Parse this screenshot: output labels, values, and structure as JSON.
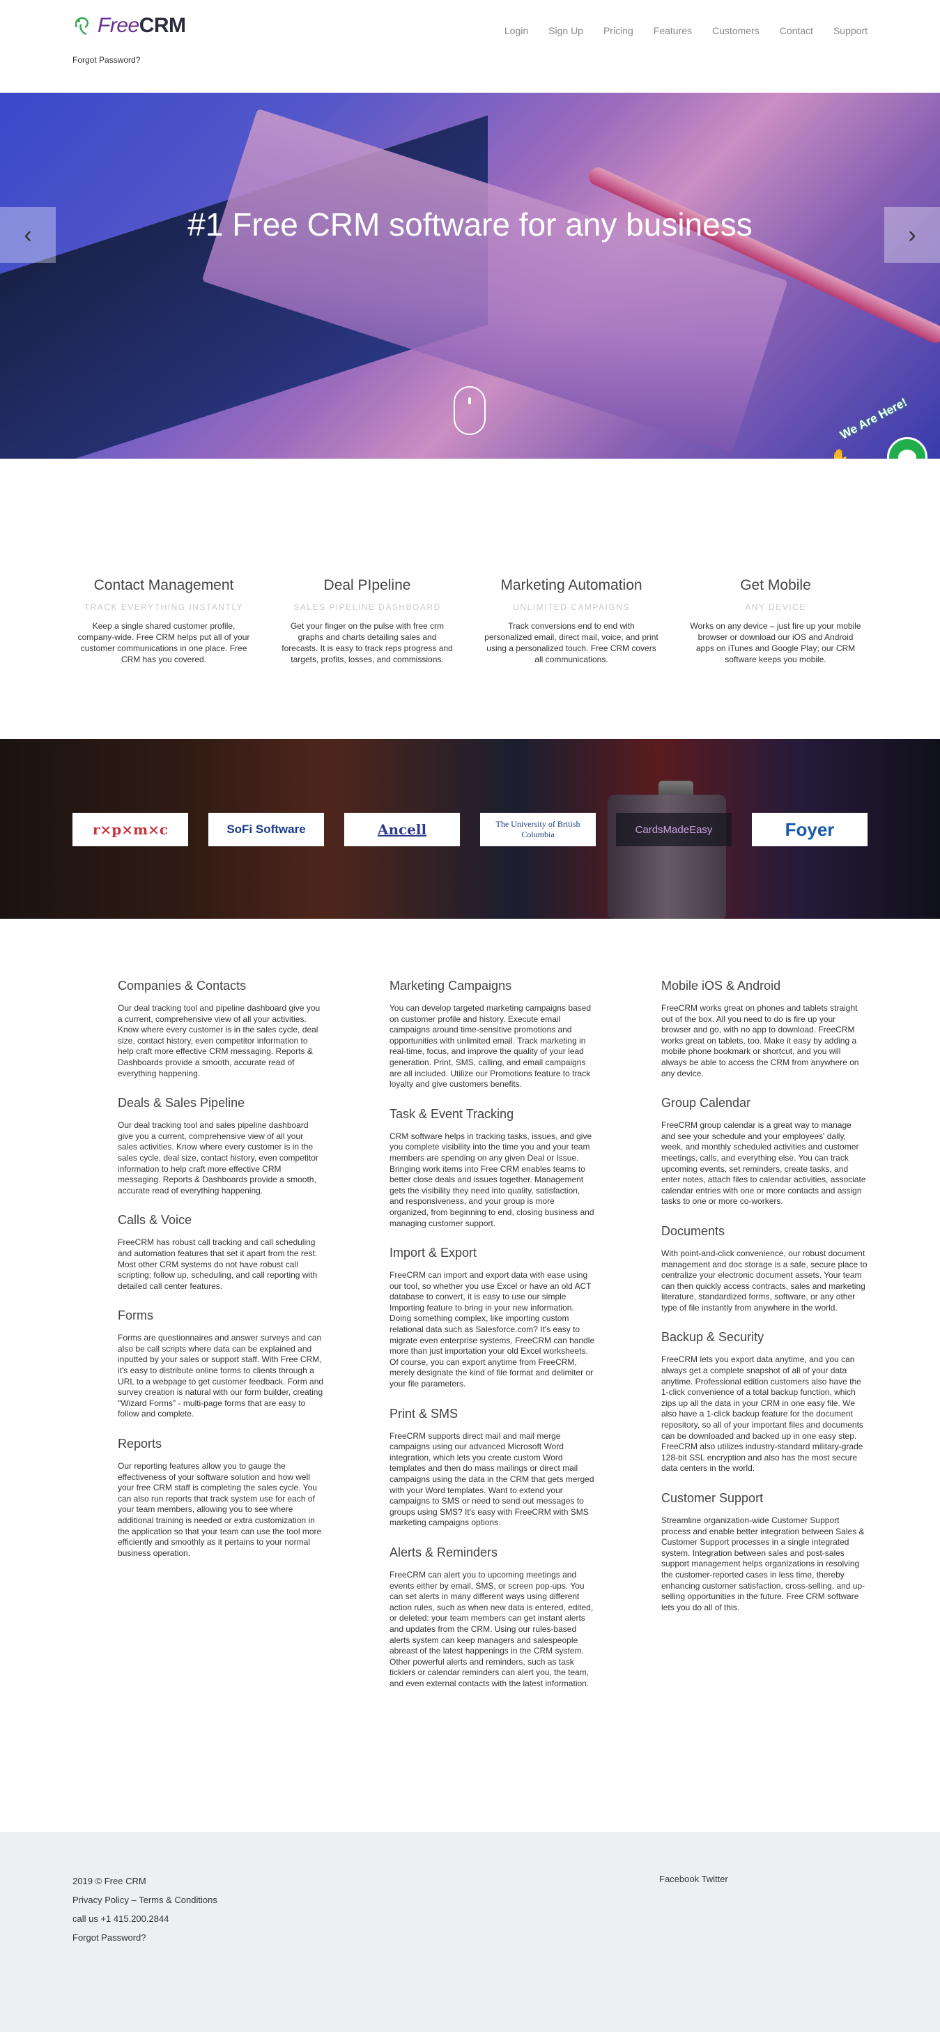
{
  "header": {
    "logo_free": "Free",
    "logo_crm": "CRM",
    "nav": [
      "Login",
      "Sign Up",
      "Pricing",
      "Features",
      "Customers",
      "Contact",
      "Support"
    ],
    "forgot_password": "Forgot Password?"
  },
  "hero": {
    "title": "#1 Free CRM software for any business",
    "prev_arrow": "‹",
    "next_arrow": "›",
    "chat_badge": "We Are Here!"
  },
  "features": [
    {
      "title": "Contact Management",
      "subtitle": "TRACK EVERYTHING INSTANTLY",
      "text": "Keep a single shared customer profile, company-wide. Free CRM helps put all of your customer communications in one place. Free CRM has you covered."
    },
    {
      "title": "Deal PIpeline",
      "subtitle": "SALES PIPELINE DASHBOARD",
      "text": "Get your finger on the pulse with free crm graphs and charts detailing sales and forecasts. It is easy to track reps progress and targets, profits, losses, and commissions."
    },
    {
      "title": "Marketing Automation",
      "subtitle": "UNLIMITED CAMPAIGNS",
      "text": "Track conversions end to end with personalized email, direct mail, voice, and print using a personalized touch. Free CRM covers all communications."
    },
    {
      "title": "Get Mobile",
      "subtitle": "ANY DEVICE",
      "text": "Works on any device – just fire up your mobile browser or download our iOS and Android apps on iTunes and Google Play; our CRM software keeps you mobile."
    }
  ],
  "clients": [
    "r×p×m×c",
    "SoFi Software",
    "Ancell",
    "The University of British Columbia",
    "CardsMadeEasy",
    "Foyer"
  ],
  "columns": {
    "col1": [
      {
        "title": "Companies & Contacts",
        "text": "Our deal tracking tool and pipeline dashboard give you a current, comprehensive view of all your activities. Know where every customer is in the sales cycle, deal size, contact history, even competitor information to help craft more effective CRM messaging. Reports & Dashboards provide a smooth, accurate read of everything happening."
      },
      {
        "title": "Deals & Sales Pipeline",
        "text": "Our deal tracking tool and sales pipeline dashboard give you a current, comprehensive view of all your sales activities. Know where every customer is in the sales cycle, deal size, contact history, even competitor information to help craft more effective CRM messaging. Reports & Dashboards provide a smooth, accurate read of everything happening."
      },
      {
        "title": "Calls & Voice",
        "text": "FreeCRM has robust call tracking and call scheduling and automation features that set it apart from the rest. Most other CRM systems do not have robust call scripting; follow up, scheduling, and call reporting with detailed call center features."
      },
      {
        "title": "Forms",
        "text": "Forms are questionnaires and answer surveys and can also be call scripts where data can be explained and inputted by your sales or support staff. With Free CRM, it's easy to distribute online forms to clients through a URL to a webpage to get customer feedback. Form and survey creation is natural with our form builder, creating \"Wizard Forms\" - multi-page forms that are easy to follow and complete."
      },
      {
        "title": "Reports",
        "text": "Our reporting features allow you to gauge the effectiveness of your software solution and how well your free CRM staff is completing the sales cycle. You can also run reports that track system use for each of your team members, allowing you to see where additional training is needed or extra customization in the application so that your team can use the tool more efficiently and smoothly as it pertains to your normal business operation."
      }
    ],
    "col2": [
      {
        "title": "Marketing Campaigns",
        "text": "You can develop targeted marketing campaigns based on customer profile and history. Execute email campaigns around time-sensitive promotions and opportunities with unlimited email. Track marketing in real-time, focus, and improve the quality of your lead generation. Print, SMS, calling, and email campaigns are all included. Utilize our Promotions feature to track loyalty and give customers benefits."
      },
      {
        "title": "Task & Event Tracking",
        "text": "CRM software helps in tracking tasks, issues, and give you complete visibility into the time you and your team members are spending on any given Deal or Issue. Bringing work items into Free CRM enables teams to better close deals and issues together. Management gets the visibility they need into quality, satisfaction, and responsiveness, and your group is more organized, from beginning to end, closing business and managing customer support."
      },
      {
        "title": "Import & Export",
        "text": "FreeCRM can import and export data with ease using our tool, so whether you use Excel or have an old ACT database to convert, it is easy to use our simple Importing feature to bring in your new information. Doing something complex, like importing custom relational data such as Salesforce.com? It's easy to migrate even enterprise systems, FreeCRM can handle more than just importation your old Excel worksheets. Of course, you can export anytime from FreeCRM, merely designate the kind of file format and delimiter or your file parameters."
      },
      {
        "title": "Print & SMS",
        "text": "FreeCRM supports direct mail and mail merge campaigns using our advanced Microsoft Word integration, which lets you create custom Word templates and then do mass mailings or direct mail campaigns using the data in the CRM that gets merged with your Word templates. Want to extend your campaigns to SMS or need to send out messages to groups using SMS? It's easy with FreeCRM with SMS marketing campaigns options."
      },
      {
        "title": "Alerts & Reminders",
        "text": "FreeCRM can alert you to upcoming meetings and events either by email, SMS, or screen pop-ups. You can set alerts in many different ways using different action rules, such as when new data is entered, edited, or deleted; your team members can get instant alerts and updates from the CRM. Using our rules-based alerts system can keep managers and salespeople abreast of the latest happenings in the CRM system. Other powerful alerts and reminders, such as task ticklers or calendar reminders can alert you, the team, and even external contacts with the latest information."
      }
    ],
    "col3": [
      {
        "title": "Mobile iOS & Android",
        "text": "FreeCRM works great on phones and tablets straight out of the box. All you need to do is fire up your browser and go, with no app to download. FreeCRM works great on tablets, too. Make it easy by adding a mobile phone bookmark or shortcut, and you will always be able to access the CRM from anywhere on any device."
      },
      {
        "title": "Group Calendar",
        "text": "FreeCRM group calendar is a great way to manage and see your schedule and your employees' daily, week, and monthly scheduled activities and customer meetings, calls, and everything else. You can track upcoming events, set reminders, create tasks, and enter notes, attach files to calendar activities, associate calendar entries with one or more contacts and assign tasks to one or more co-workers."
      },
      {
        "title": "Documents",
        "text": "With point-and-click convenience, our robust document management and doc storage is a safe, secure place to centralize your electronic document assets. Your team can then quickly access contracts, sales and marketing literature, standardized forms, software, or any other type of file instantly from anywhere in the world."
      },
      {
        "title": "Backup & Security",
        "text": "FreeCRM lets you export data anytime, and you can always get a complete snapshot of all of your data anytime. Professional edition customers also have the 1-click convenience of a total backup function, which zips up all the data in your CRM in one easy file. We also have a 1-click backup feature for the document repository, so all of your important files and documents can be downloaded and backed up in one easy step. FreeCRM also utilizes industry-standard military-grade 128-bit SSL encryption and also has the most secure data centers in the world."
      },
      {
        "title": "Customer Support",
        "text": "Streamline organization-wide Customer Support process and enable better integration between Sales & Customer Support processes in a single integrated system. Integration between sales and post-sales support management helps organizations in resolving the customer-reported cases in less time, thereby enhancing customer satisfaction, cross-selling, and up-selling opportunities in the future. Free CRM software lets you do all of this."
      }
    ]
  },
  "footer": {
    "copyright": "2019 © Free CRM",
    "legal": "Privacy Policy – Terms & Conditions",
    "phone": "call us +1 415.200.2844",
    "forgot": "Forgot Password?",
    "social": "Facebook Twitter"
  }
}
